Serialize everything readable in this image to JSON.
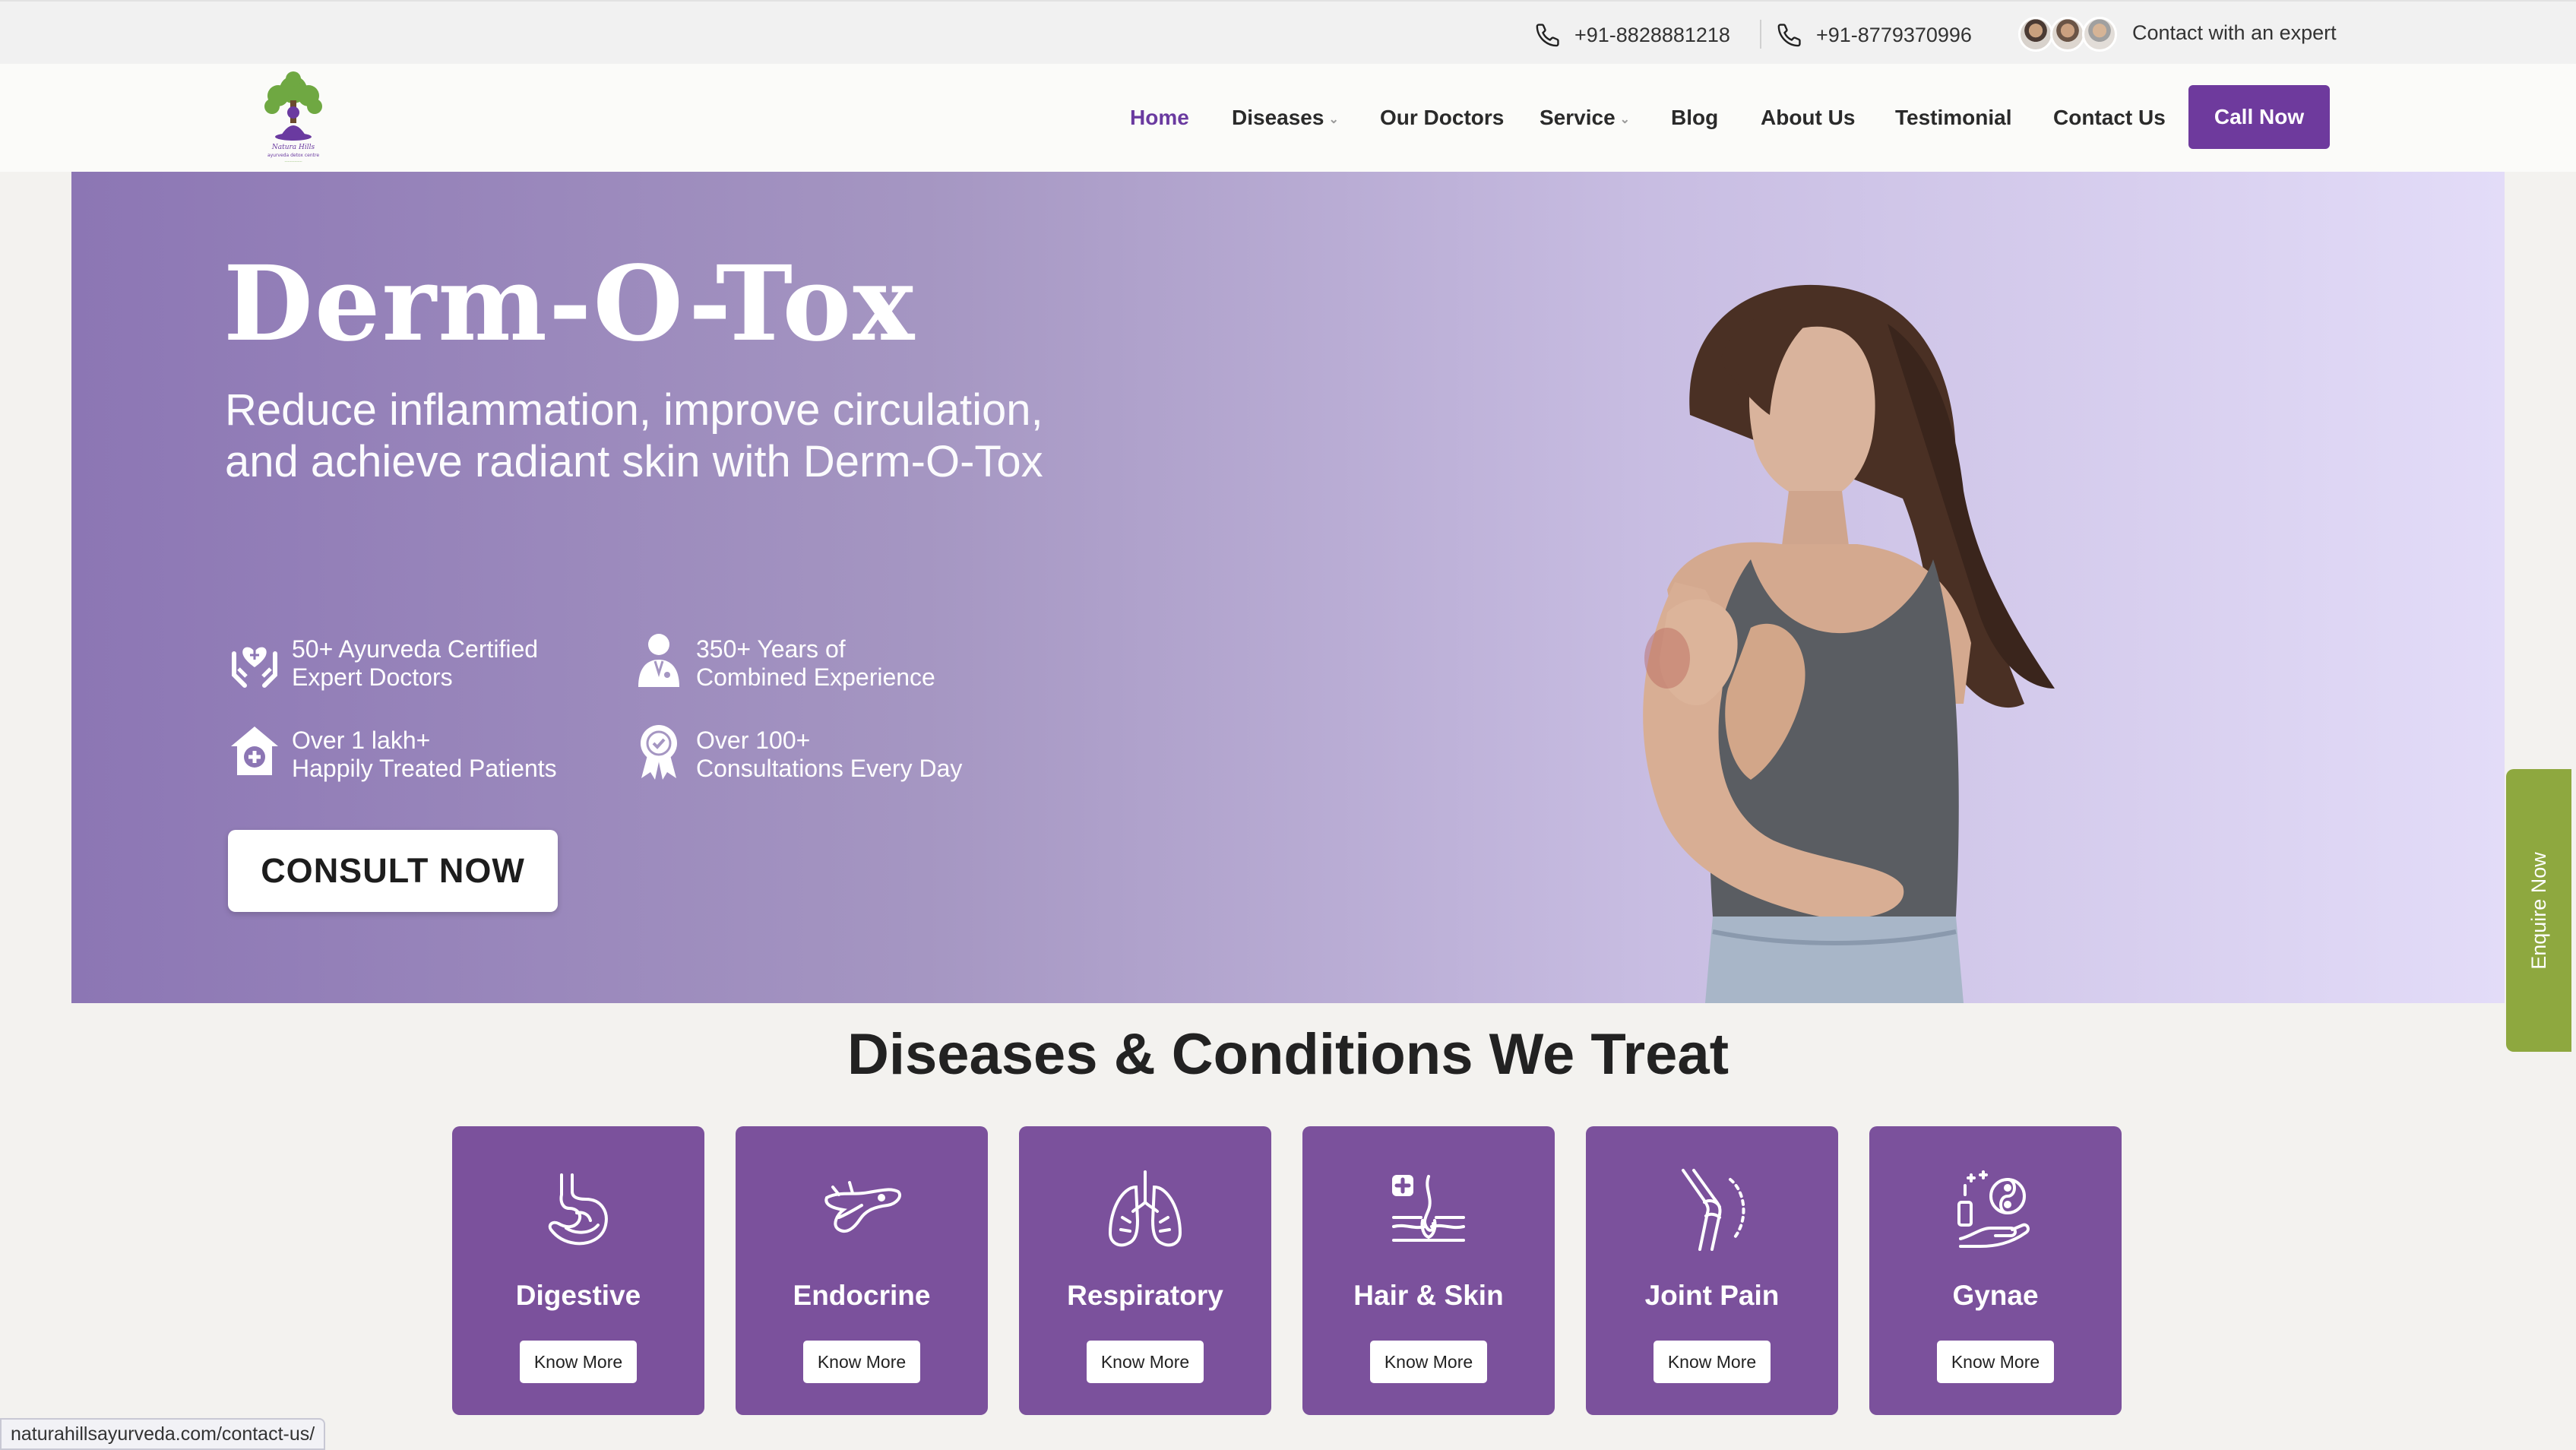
{
  "topbar": {
    "phone1": "+91-8828881218",
    "phone2": "+91-8779370996",
    "expert_text": "Contact with an expert"
  },
  "nav": {
    "items": [
      "Home",
      "Diseases",
      "Our Doctors",
      "Service",
      "Blog",
      "About Us",
      "Testimonial",
      "Contact Us"
    ],
    "active": "Home",
    "call_label": "Call Now"
  },
  "hero": {
    "title": "Derm-O-Tox",
    "subtitle_line1": "Reduce inflammation, improve circulation,",
    "subtitle_line2": "and achieve radiant skin with Derm-O-Tox",
    "stats": [
      {
        "line1": "50+ Ayurveda Certified",
        "line2": "Expert Doctors",
        "icon": "hands-heart-icon"
      },
      {
        "line1": "350+ Years of",
        "line2": "Combined Experience",
        "icon": "doctor-icon"
      },
      {
        "line1": "Over 1 lakh+",
        "line2": "Happily Treated Patients",
        "icon": "hospital-icon"
      },
      {
        "line1": "Over 100+",
        "line2": "Consultations Every Day",
        "icon": "badge-icon"
      }
    ],
    "cta": "CONSULT NOW"
  },
  "enquire_label": "Enquire Now",
  "section_title": "Diseases & Conditions We Treat",
  "categories": [
    {
      "name": "Digestive",
      "button": "Know More",
      "icon": "stomach-icon"
    },
    {
      "name": "Endocrine",
      "button": "Know More",
      "icon": "pancreas-icon"
    },
    {
      "name": "Respiratory",
      "button": "Know More",
      "icon": "lungs-icon"
    },
    {
      "name": "Hair & Skin",
      "button": "Know More",
      "icon": "hair-follicle-icon"
    },
    {
      "name": "Joint Pain",
      "button": "Know More",
      "icon": "knee-joint-icon"
    },
    {
      "name": "Gynae",
      "button": "Know More",
      "icon": "gynae-icon"
    }
  ],
  "status_url": "naturahillsayurveda.com/contact-us/",
  "colors": {
    "brand_purple": "#6e3a9d",
    "card_purple": "#7b519c",
    "enquire_green": "#8ea83f"
  }
}
